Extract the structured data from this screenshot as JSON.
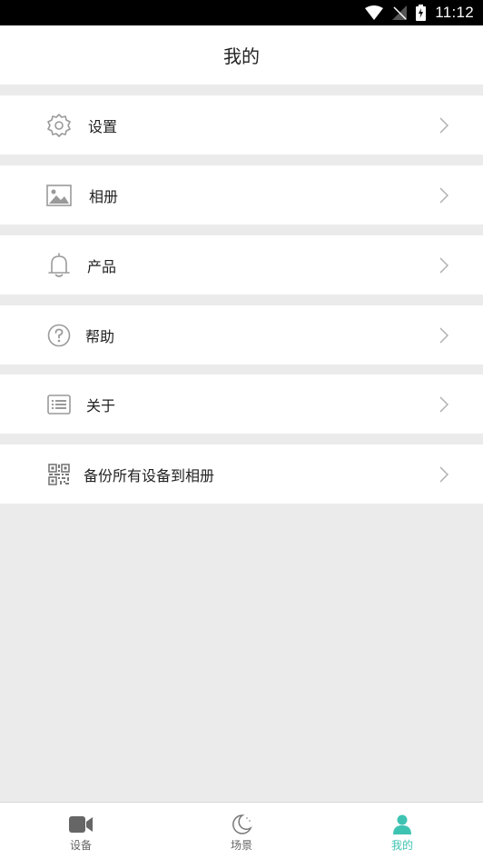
{
  "status_bar": {
    "time": "11:12"
  },
  "header": {
    "title": "我的"
  },
  "menu": [
    {
      "label": "设置",
      "icon": "gear-icon"
    },
    {
      "label": "相册",
      "icon": "image-icon"
    },
    {
      "label": "产品",
      "icon": "bell-icon"
    },
    {
      "label": "帮助",
      "icon": "help-icon"
    },
    {
      "label": "关于",
      "icon": "list-icon"
    },
    {
      "label": "备份所有设备到相册",
      "icon": "qr-code-icon"
    }
  ],
  "bottom_nav": {
    "tabs": [
      {
        "label": "设备",
        "icon": "video-camera-icon"
      },
      {
        "label": "场景",
        "icon": "moon-icon"
      },
      {
        "label": "我的",
        "icon": "person-icon",
        "active": true
      }
    ]
  },
  "colors": {
    "accent": "#3ec3b3",
    "icon_gray": "#9a9a9a",
    "background": "#ebebeb"
  }
}
